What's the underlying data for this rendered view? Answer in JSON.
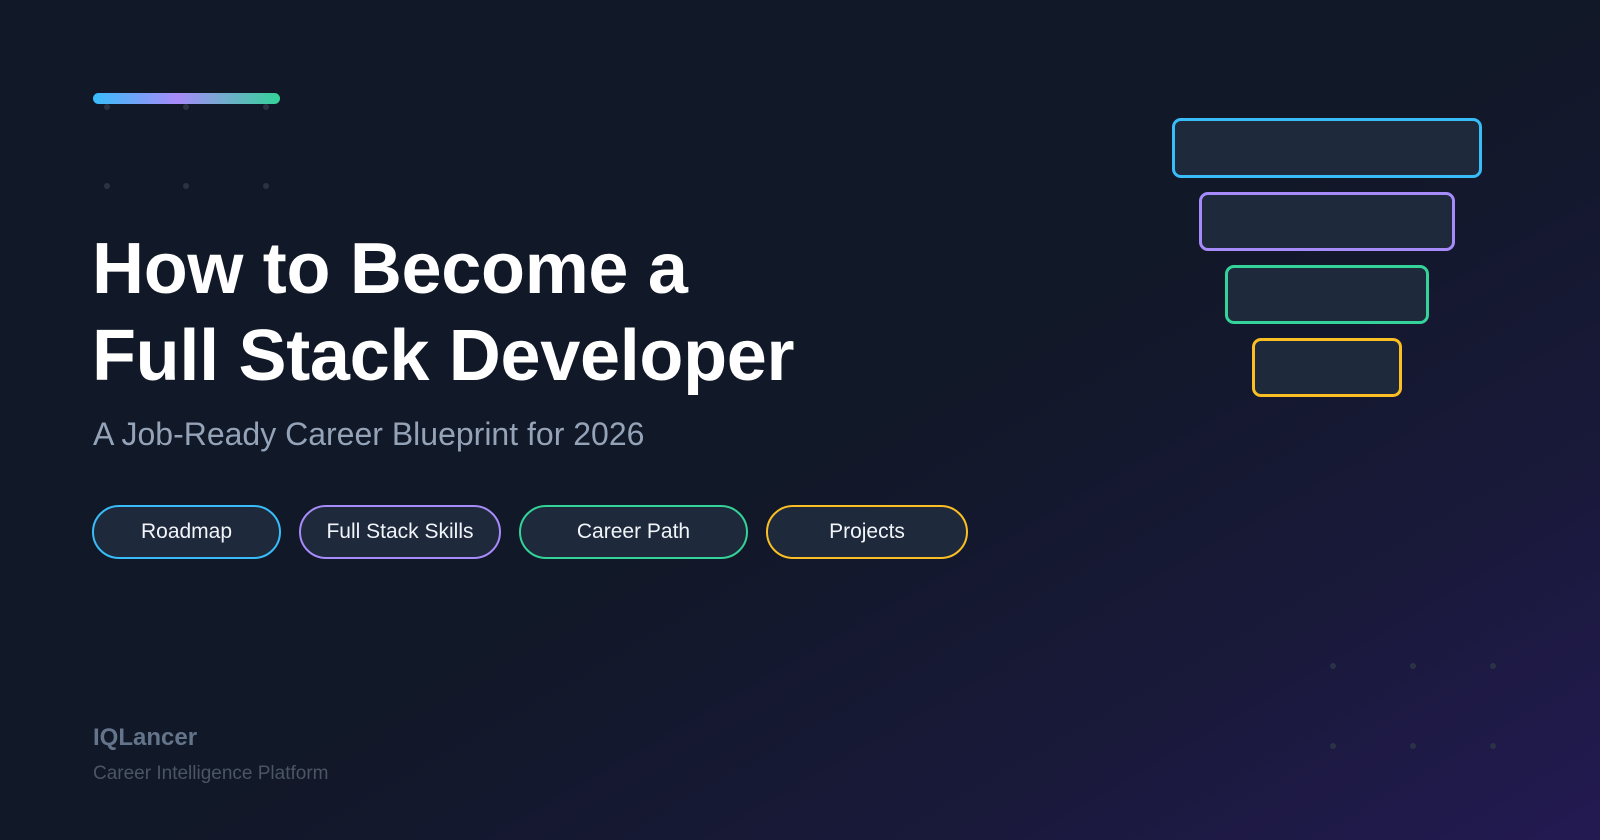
{
  "hero": {
    "title_line1": "How to Become a",
    "title_line2": "Full Stack Developer",
    "subtitle": "A Job-Ready Career Blueprint for 2026"
  },
  "tags": [
    {
      "label": "Roadmap",
      "color": "#38bdf8"
    },
    {
      "label": "Full Stack Skills",
      "color": "#a78bfa"
    },
    {
      "label": "Career Path",
      "color": "#34d399"
    },
    {
      "label": "Projects",
      "color": "#fbbf24"
    }
  ],
  "funnel": {
    "layer_colors": [
      "#38bdf8",
      "#a78bfa",
      "#34d399",
      "#fbbf24"
    ]
  },
  "brand": {
    "name": "IQLancer",
    "tagline": "Career Intelligence Platform"
  },
  "colors": {
    "background": "#111827",
    "background_glow": "#231a52",
    "title": "#ffffff",
    "subtitle": "#94a3b8",
    "tag_fill": "#1e293b"
  }
}
